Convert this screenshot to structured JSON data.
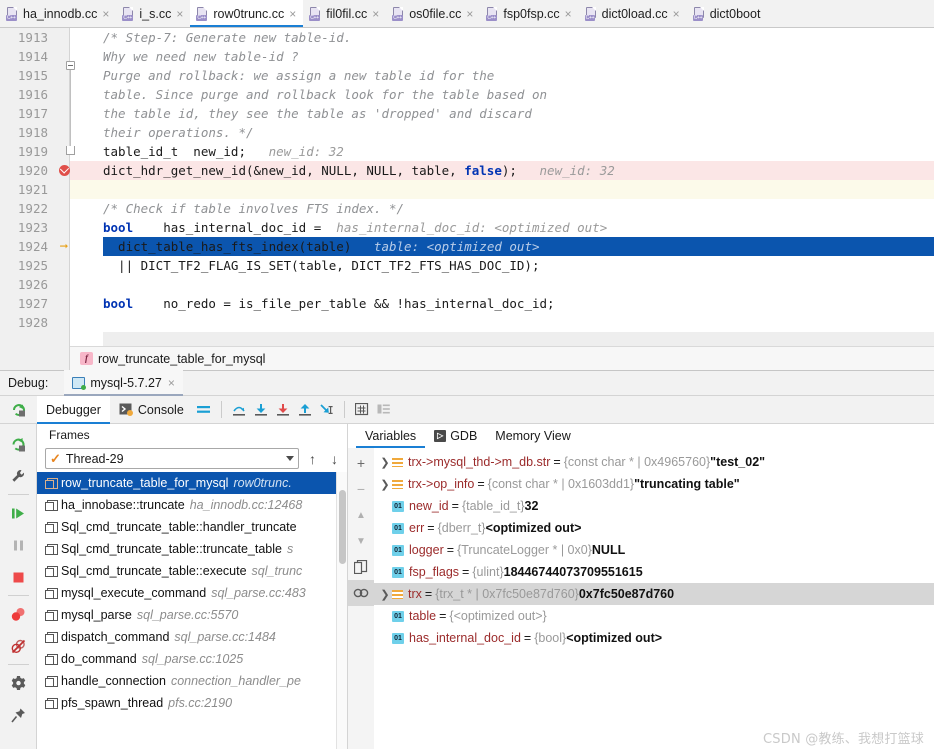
{
  "editor_tabs": [
    {
      "label": "ha_innodb.cc",
      "active": false,
      "closable": true
    },
    {
      "label": "i_s.cc",
      "active": false,
      "closable": true
    },
    {
      "label": "row0trunc.cc",
      "active": true,
      "closable": true
    },
    {
      "label": "fil0fil.cc",
      "active": false,
      "closable": true
    },
    {
      "label": "os0file.cc",
      "active": false,
      "closable": true
    },
    {
      "label": "fsp0fsp.cc",
      "active": false,
      "closable": true
    },
    {
      "label": "dict0load.cc",
      "active": false,
      "closable": true
    },
    {
      "label": "dict0boot",
      "active": false,
      "closable": false
    }
  ],
  "tab_close_glyph": "×",
  "file_icon_label": "C++",
  "code": {
    "lines": [
      {
        "num": "1913",
        "indent": 0,
        "marker": "",
        "fold": "start",
        "highlight": "none",
        "segments": [
          {
            "t": "comment",
            "s": "/* Step-7: Generate new table-id."
          }
        ]
      },
      {
        "num": "1914",
        "indent": 0,
        "marker": "",
        "fold": "",
        "highlight": "none",
        "segments": [
          {
            "t": "comment",
            "s": "Why we need new table-id ?"
          }
        ]
      },
      {
        "num": "1915",
        "indent": 0,
        "marker": "",
        "fold": "",
        "highlight": "none",
        "segments": [
          {
            "t": "comment",
            "s": "Purge and rollback: we assign a new table id for the"
          }
        ]
      },
      {
        "num": "1916",
        "indent": 0,
        "marker": "",
        "fold": "",
        "highlight": "none",
        "segments": [
          {
            "t": "comment",
            "s": "table. Since purge and rollback look for the table based on"
          }
        ]
      },
      {
        "num": "1917",
        "indent": 0,
        "marker": "",
        "fold": "",
        "highlight": "none",
        "segments": [
          {
            "t": "comment",
            "s": "the table id, they see the table as 'dropped' and discard"
          }
        ]
      },
      {
        "num": "1918",
        "indent": 0,
        "marker": "",
        "fold": "end",
        "highlight": "none",
        "segments": [
          {
            "t": "comment",
            "s": "their operations. */"
          }
        ]
      },
      {
        "num": "1919",
        "indent": 0,
        "marker": "",
        "fold": "",
        "highlight": "none",
        "segments": [
          {
            "t": "plain",
            "s": "table_id_t  new_id;"
          },
          {
            "t": "inline",
            "s": "   new_id: 32"
          }
        ]
      },
      {
        "num": "1920",
        "indent": 0,
        "marker": "breakpoint",
        "fold": "",
        "highlight": "red",
        "segments": [
          {
            "t": "plain",
            "s": "dict_hdr_get_new_id(&new_id, NULL, NULL, table, "
          },
          {
            "t": "keyword",
            "s": "false"
          },
          {
            "t": "plain",
            "s": ");"
          },
          {
            "t": "inline",
            "s": "   new_id: 32"
          }
        ]
      },
      {
        "num": "1921",
        "indent": 0,
        "marker": "",
        "fold": "",
        "highlight": "cream",
        "segments": []
      },
      {
        "num": "1922",
        "indent": 0,
        "marker": "",
        "fold": "",
        "highlight": "none",
        "segments": [
          {
            "t": "comment",
            "s": "/* Check if table involves FTS index. */"
          }
        ]
      },
      {
        "num": "1923",
        "indent": 0,
        "marker": "",
        "fold": "",
        "highlight": "none",
        "segments": [
          {
            "t": "keyword",
            "s": "bool"
          },
          {
            "t": "plain",
            "s": "    has_internal_doc_id = "
          },
          {
            "t": "inline",
            "s": " has_internal_doc_id: <optimized out>"
          }
        ]
      },
      {
        "num": "1924",
        "indent": 1,
        "marker": "exec-arrow",
        "fold": "",
        "highlight": "exec",
        "segments": [
          {
            "t": "plain",
            "s": "  dict_table_has_fts_index(table)"
          },
          {
            "t": "inline",
            "s": "   table: <optimized out>"
          }
        ]
      },
      {
        "num": "1925",
        "indent": 1,
        "marker": "",
        "fold": "",
        "highlight": "none",
        "segments": [
          {
            "t": "plain",
            "s": "  || DICT_TF2_FLAG_IS_SET(table, DICT_TF2_FTS_HAS_DOC_ID);"
          }
        ]
      },
      {
        "num": "1926",
        "indent": 0,
        "marker": "",
        "fold": "",
        "highlight": "none",
        "segments": []
      },
      {
        "num": "1927",
        "indent": 0,
        "marker": "",
        "fold": "",
        "highlight": "none",
        "segments": [
          {
            "t": "keyword",
            "s": "bool"
          },
          {
            "t": "plain",
            "s": "    no_redo = is_file_per_table && !has_internal_doc_id;"
          }
        ]
      },
      {
        "num": "1928",
        "indent": 0,
        "marker": "",
        "fold": "",
        "highlight": "none",
        "segments": []
      }
    ]
  },
  "breadcrumb": {
    "icon_letter": "f",
    "label": "row_truncate_table_for_mysql"
  },
  "debug": {
    "label": "Debug:",
    "session_tab": "mysql-5.7.27",
    "session_close_glyph": "×",
    "tabs": [
      {
        "label": "Debugger",
        "active": true
      },
      {
        "label": "Console",
        "active": false
      }
    ],
    "toolbar_icons": [
      "layout-icon",
      "step-over-icon",
      "step-into-icon",
      "force-step-into-icon",
      "step-out-icon",
      "run-to-cursor-icon",
      "evaluate-expression-icon",
      "show-options-icon"
    ],
    "rail_icons": [
      "rerun-icon",
      "settings-wrench-icon",
      "resume-program-icon",
      "pause-program-icon",
      "stop-icon",
      "view-breakpoints-icon",
      "mute-breakpoints-icon",
      "settings-gear-icon",
      "pin-tab-icon"
    ]
  },
  "frames": {
    "header": "Frames",
    "thread": "Thread-29",
    "items": [
      {
        "name": "row_truncate_table_for_mysql",
        "loc": "row0trunc.",
        "selected": true
      },
      {
        "name": "ha_innobase::truncate",
        "loc": "ha_innodb.cc:12468",
        "selected": false
      },
      {
        "name": "Sql_cmd_truncate_table::handler_truncate",
        "loc": "",
        "selected": false
      },
      {
        "name": "Sql_cmd_truncate_table::truncate_table",
        "loc": "s",
        "selected": false
      },
      {
        "name": "Sql_cmd_truncate_table::execute",
        "loc": "sql_trunc",
        "selected": false
      },
      {
        "name": "mysql_execute_command",
        "loc": "sql_parse.cc:483",
        "selected": false
      },
      {
        "name": "mysql_parse",
        "loc": "sql_parse.cc:5570",
        "selected": false
      },
      {
        "name": "dispatch_command",
        "loc": "sql_parse.cc:1484",
        "selected": false
      },
      {
        "name": "do_command",
        "loc": "sql_parse.cc:1025",
        "selected": false
      },
      {
        "name": "handle_connection",
        "loc": "connection_handler_pe",
        "selected": false
      },
      {
        "name": "pfs_spawn_thread",
        "loc": "pfs.cc:2190",
        "selected": false
      }
    ]
  },
  "variables": {
    "tabs": [
      {
        "label": "Variables",
        "active": true
      },
      {
        "label": "GDB",
        "active": false
      },
      {
        "label": "Memory View",
        "active": false
      }
    ],
    "rail_icons": [
      "add-watch-icon",
      "remove-watch-icon",
      "move-up-icon",
      "move-down-icon",
      "copy-value-icon",
      "inspect-icon"
    ],
    "rows": [
      {
        "expandable": true,
        "icon": "array-icon",
        "name": "trx->mysql_thd->m_db.str",
        "type": "{const char * | 0x4965760}",
        "value": "\"test_02\"",
        "selected": false
      },
      {
        "expandable": true,
        "icon": "array-icon",
        "name": "trx->op_info",
        "type": "{const char * | 0x1603dd1}",
        "value": "\"truncating table\"",
        "selected": false
      },
      {
        "expandable": false,
        "icon": "primitive-icon",
        "name": "new_id",
        "type": "{table_id_t}",
        "value": "32",
        "selected": false
      },
      {
        "expandable": false,
        "icon": "primitive-icon",
        "name": "err",
        "type": "{dberr_t}",
        "value": "<optimized out>",
        "selected": false
      },
      {
        "expandable": false,
        "icon": "primitive-icon",
        "name": "logger",
        "type": "{TruncateLogger * | 0x0}",
        "value": "NULL",
        "selected": false
      },
      {
        "expandable": false,
        "icon": "primitive-icon",
        "name": "fsp_flags",
        "type": "{ulint}",
        "value": "18446744073709551615",
        "selected": false
      },
      {
        "expandable": true,
        "icon": "array-icon",
        "name": "trx",
        "type": "{trx_t * | 0x7fc50e87d760}",
        "value": "0x7fc50e87d760",
        "selected": true
      },
      {
        "expandable": false,
        "icon": "primitive-icon",
        "name": "table",
        "type": "{<optimized out>}",
        "value": "",
        "selected": false
      },
      {
        "expandable": false,
        "icon": "primitive-icon",
        "name": "has_internal_doc_id",
        "type": "{bool}",
        "value": "<optimized out>",
        "selected": false
      }
    ]
  },
  "watermark": "CSDN @教练、我想打篮球",
  "colors": {
    "accent": "#1a7fd4",
    "selection": "#0b55ae",
    "breakpoint": "#e0504a",
    "exec_arrow": "#e8a117",
    "var_name": "#9b2b2b"
  }
}
